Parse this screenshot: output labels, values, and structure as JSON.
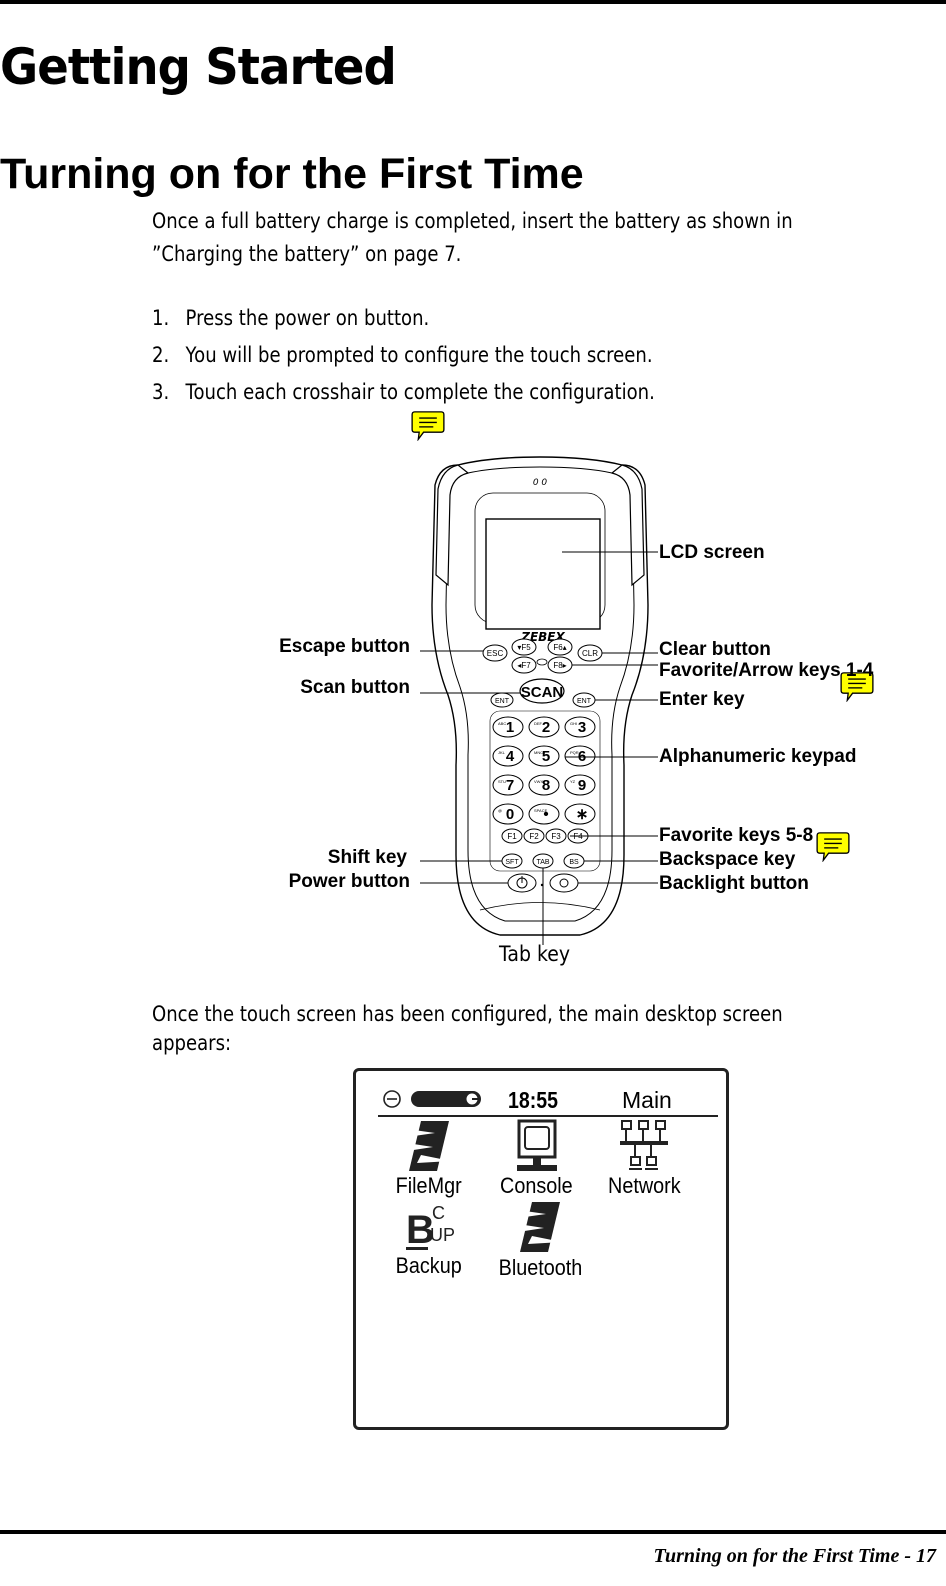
{
  "page": {
    "chapter_title": "Getting Started",
    "section_title": "Turning on for the First Time",
    "intro_line1": "Once a full battery charge is completed, insert the battery as shown in",
    "intro_line2": "”Charging the battery” on page 7.",
    "steps": [
      {
        "num": "1.",
        "text": "Press the power on button."
      },
      {
        "num": "2.",
        "text": "You will be prompted to configure the touch screen."
      },
      {
        "num": "3.",
        "text": "Touch each crosshair to complete the configuration."
      }
    ],
    "after_line1": "Once the touch screen has been configured, the main desktop screen",
    "after_line2": "appears:",
    "footer": "Turning on for the First Time - 17"
  },
  "device_diagram": {
    "brand": "ZEBEX",
    "callouts_left": [
      {
        "id": "escape",
        "label": "Escape button"
      },
      {
        "id": "scan",
        "label": "Scan button"
      },
      {
        "id": "shift",
        "label": "Shift key"
      },
      {
        "id": "power",
        "label": "Power button"
      }
    ],
    "callouts_right": [
      {
        "id": "lcd",
        "label": "LCD screen"
      },
      {
        "id": "clear",
        "label": "Clear button"
      },
      {
        "id": "favorite-arrow",
        "label": "Favorite/Arrow keys 1-4"
      },
      {
        "id": "enter",
        "label": "Enter key"
      },
      {
        "id": "alphanumeric",
        "label": "Alphanumeric keypad"
      },
      {
        "id": "favorite-5-8",
        "label": "Favorite keys 5-8"
      },
      {
        "id": "backspace",
        "label": "Backspace key"
      },
      {
        "id": "backlight",
        "label": "Backlight button"
      }
    ],
    "callout_bottom": "Tab key",
    "keys": {
      "esc": "ESC",
      "f5": "▾F5",
      "f6": "F6▴",
      "clr": "CLR",
      "f7": "◂F7",
      "f8": "F8▸",
      "scan": "SCAN",
      "ent": "ENT",
      "digits": [
        "1",
        "2",
        "3",
        "4",
        "5",
        "6",
        "7",
        "8",
        "9",
        "0",
        "•",
        "∗"
      ],
      "sub": [
        "ABC",
        "DEF",
        "GHI",
        "JKL",
        "MNO",
        "PQR",
        "STU",
        "VWX",
        "YZ",
        "@",
        "SPACE",
        ""
      ],
      "fkeys": [
        "F1",
        "F2",
        "F3",
        "F4"
      ],
      "sft": "SFT",
      "tab": "TAB",
      "bs": "BS"
    }
  },
  "desktop_screen": {
    "clock": "18:55",
    "title": "Main",
    "apps": [
      {
        "label": "FileMgr",
        "icon": "filemgr-icon"
      },
      {
        "label": "Console",
        "icon": "console-icon"
      },
      {
        "label": "Network",
        "icon": "network-icon"
      },
      {
        "label": "Backup",
        "icon": "backup-icon"
      },
      {
        "label": "Bluetooth",
        "icon": "bluetooth-icon"
      }
    ]
  },
  "annotation_color": "#ffff00"
}
